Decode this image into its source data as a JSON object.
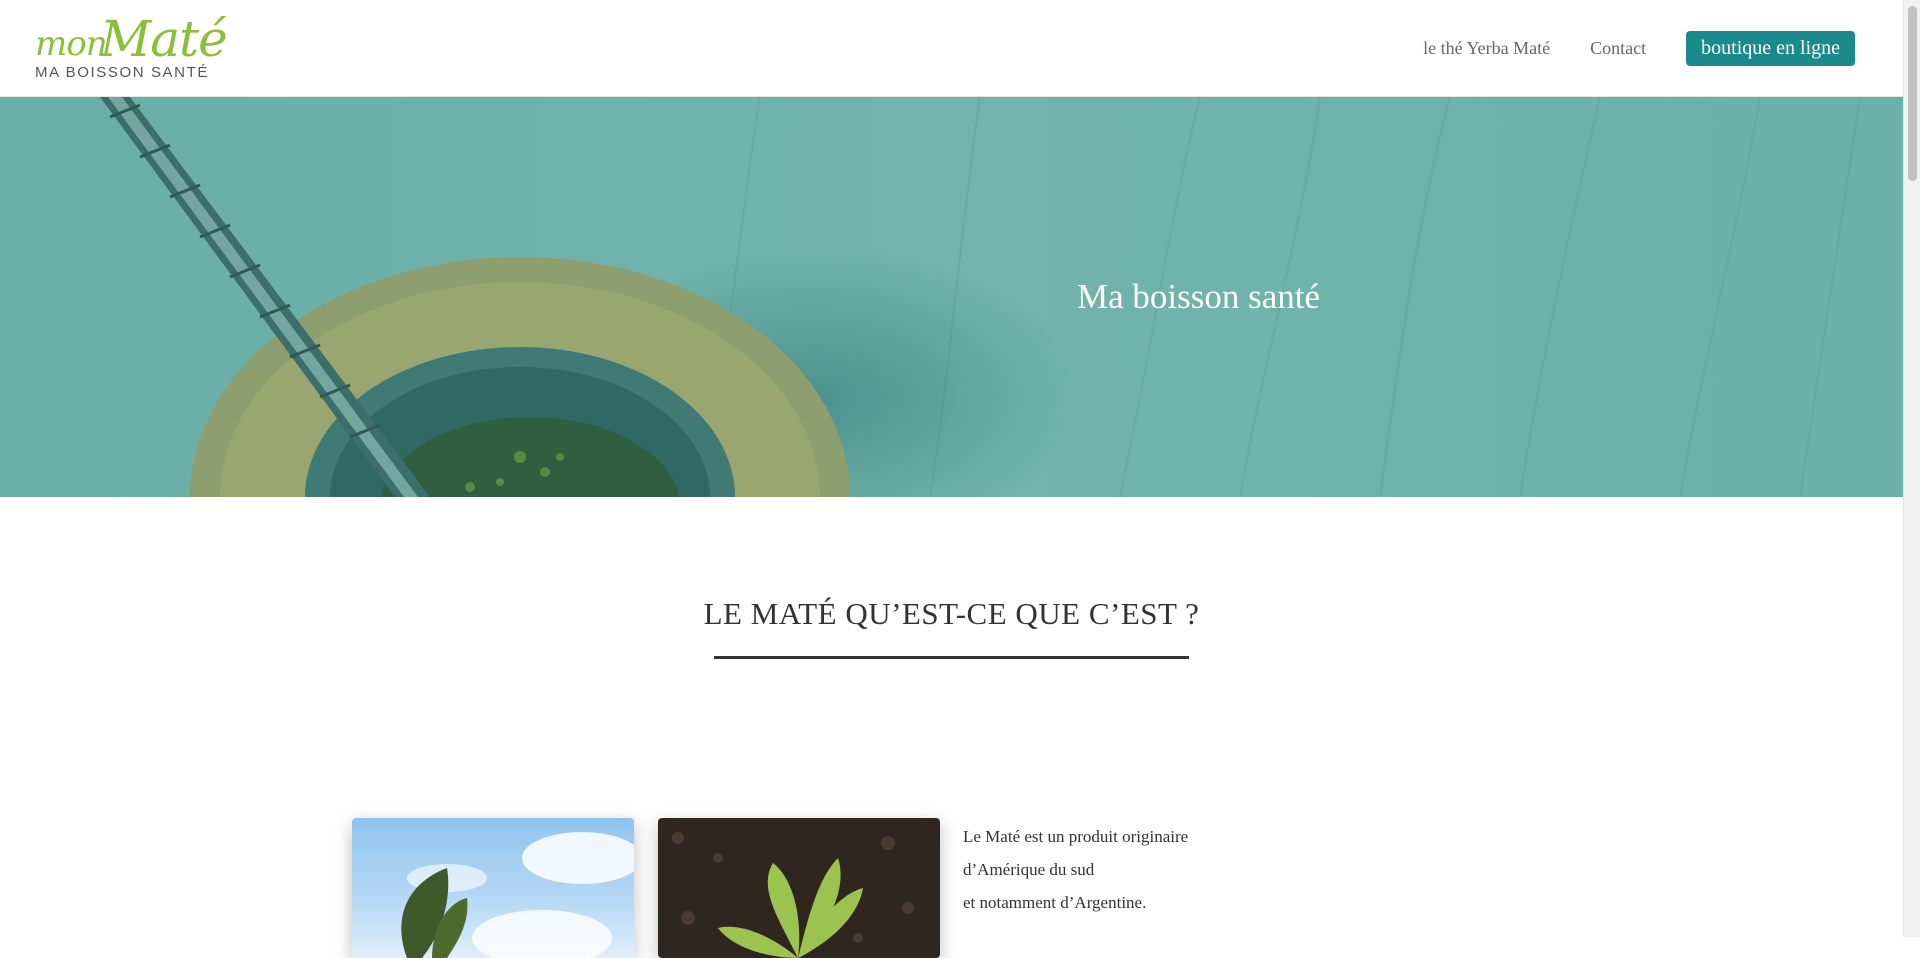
{
  "logo": {
    "word1": "mon",
    "word2": "Maté",
    "tagline": "MA BOISSON SANTÉ"
  },
  "nav": {
    "items": [
      {
        "label": "le thé Yerba Maté"
      },
      {
        "label": "Contact"
      }
    ],
    "shop_button": "boutique en ligne"
  },
  "hero": {
    "title": "Ma boisson santé"
  },
  "section": {
    "title": "LE MATÉ QU’EST-CE QUE C’EST ?",
    "intro_lines": [
      "Le Maté est un produit originaire",
      "d’Amérique du sud",
      "et notamment d’Argentine."
    ]
  },
  "colors": {
    "brand_green": "#8bbf3a",
    "accent_teal": "#1a8a8c",
    "hero_overlay": "#6fb0aa"
  }
}
